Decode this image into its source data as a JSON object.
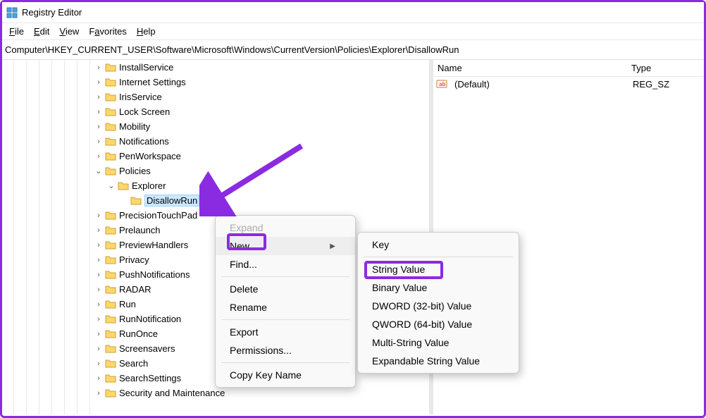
{
  "title": "Registry Editor",
  "menu": {
    "file": "File",
    "edit": "Edit",
    "view": "View",
    "favorites": "Favorites",
    "help": "Help"
  },
  "path": "Computer\\HKEY_CURRENT_USER\\Software\\Microsoft\\Windows\\CurrentVersion\\Policies\\Explorer\\DisallowRun",
  "columns": {
    "name": "Name",
    "type": "Type"
  },
  "value_row": {
    "name": "(Default)",
    "type": "REG_SZ"
  },
  "tree": {
    "items": [
      {
        "label": "InstallService",
        "indent": 130,
        "chev": ">"
      },
      {
        "label": "Internet Settings",
        "indent": 130,
        "chev": ">"
      },
      {
        "label": "IrisService",
        "indent": 130,
        "chev": ">"
      },
      {
        "label": "Lock Screen",
        "indent": 130,
        "chev": ">"
      },
      {
        "label": "Mobility",
        "indent": 130,
        "chev": ">"
      },
      {
        "label": "Notifications",
        "indent": 130,
        "chev": ">"
      },
      {
        "label": "PenWorkspace",
        "indent": 130,
        "chev": ">"
      },
      {
        "label": "Policies",
        "indent": 130,
        "chev": "v"
      },
      {
        "label": "Explorer",
        "indent": 148,
        "chev": "v"
      },
      {
        "label": "DisallowRun",
        "indent": 166,
        "chev": "",
        "selected": true
      },
      {
        "label": "PrecisionTouchPad",
        "indent": 130,
        "chev": ">"
      },
      {
        "label": "Prelaunch",
        "indent": 130,
        "chev": ">"
      },
      {
        "label": "PreviewHandlers",
        "indent": 130,
        "chev": ">"
      },
      {
        "label": "Privacy",
        "indent": 130,
        "chev": ">"
      },
      {
        "label": "PushNotifications",
        "indent": 130,
        "chev": ">"
      },
      {
        "label": "RADAR",
        "indent": 130,
        "chev": ">"
      },
      {
        "label": "Run",
        "indent": 130,
        "chev": ">"
      },
      {
        "label": "RunNotification",
        "indent": 130,
        "chev": ">"
      },
      {
        "label": "RunOnce",
        "indent": 130,
        "chev": ">"
      },
      {
        "label": "Screensavers",
        "indent": 130,
        "chev": ">"
      },
      {
        "label": "Search",
        "indent": 130,
        "chev": ">"
      },
      {
        "label": "SearchSettings",
        "indent": 130,
        "chev": ">"
      },
      {
        "label": "Security and Maintenance",
        "indent": 130,
        "chev": ">"
      }
    ]
  },
  "context_main": {
    "expand": "Expand",
    "new": "New",
    "find": "Find...",
    "delete": "Delete",
    "rename": "Rename",
    "export": "Export",
    "permissions": "Permissions...",
    "copykey": "Copy Key Name"
  },
  "context_new": {
    "key": "Key",
    "string": "String Value",
    "binary": "Binary Value",
    "dword": "DWORD (32-bit) Value",
    "qword": "QWORD (64-bit) Value",
    "multi": "Multi-String Value",
    "expand": "Expandable String Value"
  }
}
